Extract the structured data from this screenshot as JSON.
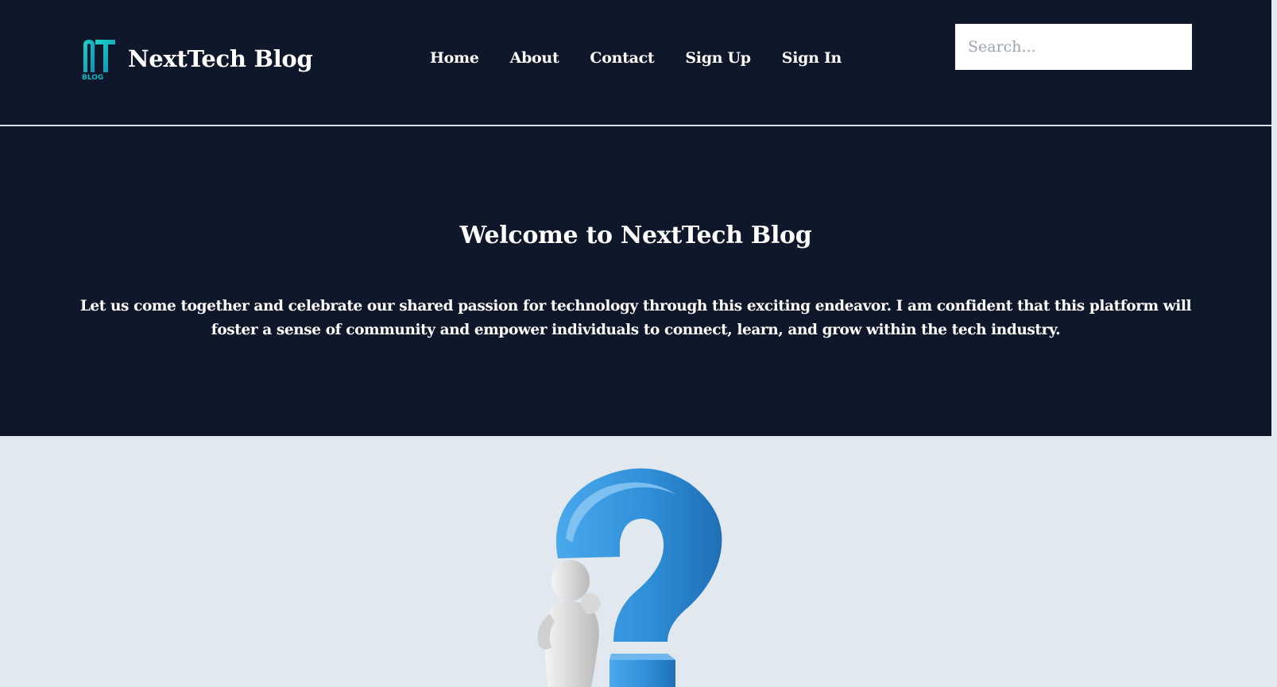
{
  "header": {
    "brand_name": "NextTech Blog",
    "logo_letters": "NT",
    "logo_sub": "BLOG",
    "nav": [
      {
        "label": "Home"
      },
      {
        "label": "About"
      },
      {
        "label": "Contact"
      },
      {
        "label": "Sign Up"
      },
      {
        "label": "Sign In"
      }
    ],
    "search": {
      "placeholder": "Search...",
      "value": ""
    }
  },
  "hero": {
    "title": "Welcome to NextTech Blog",
    "text": "Let us come together and celebrate our shared passion for technology through this exciting endeavor. I am confident that this platform will foster a sense of community and empower individuals to connect, learn, and grow within the tech industry."
  },
  "illustration": {
    "icon": "question-mark-person-illustration"
  },
  "colors": {
    "header_bg": "#0f172a",
    "page_bg": "#e2e8f0",
    "logo_accent": "#14b8c4",
    "question_mark": "#2f8fd8"
  }
}
